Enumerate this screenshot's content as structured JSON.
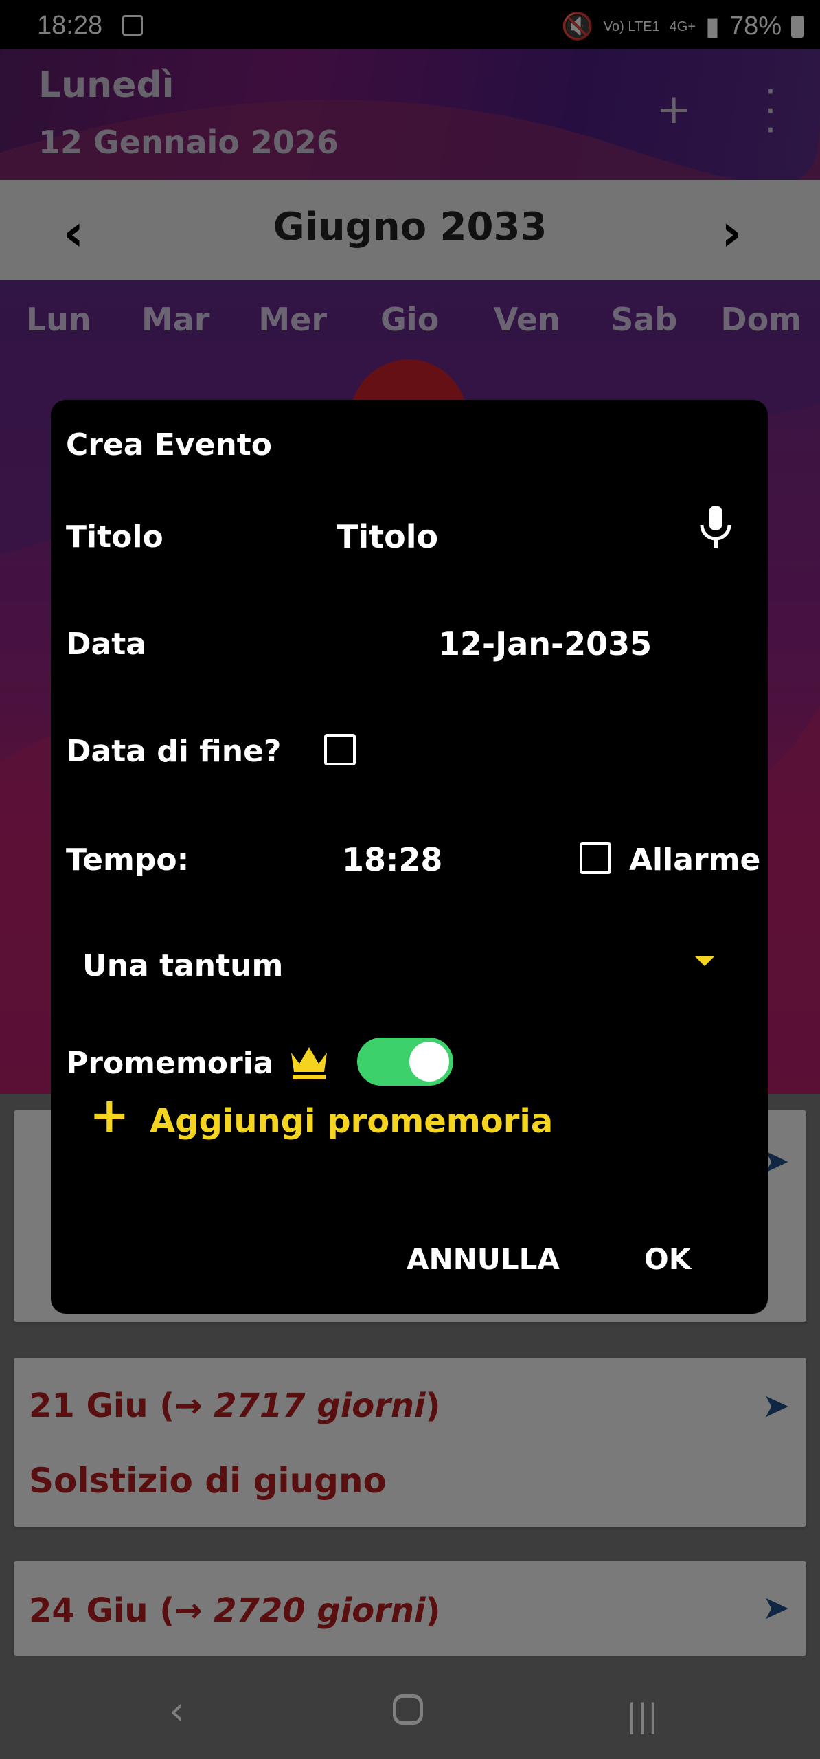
{
  "status": {
    "time": "18:28",
    "network": "Vo) LTE1",
    "network2": "4G+",
    "battery": "78%"
  },
  "header": {
    "day": "Lunedì",
    "date": "12 Gennaio 2026"
  },
  "calendar": {
    "month_title": "Giugno 2033",
    "weekdays": [
      "Lun",
      "Mar",
      "Mer",
      "Gio",
      "Ven",
      "Sab",
      "Dom"
    ]
  },
  "events": [
    {
      "date": "21 Giu",
      "days": "2717 giorni",
      "name": "Solstizio di giugno"
    },
    {
      "date": "24 Giu",
      "days": "2720 giorni"
    }
  ],
  "dialog": {
    "title": "Crea Evento",
    "title_label": "Titolo",
    "title_placeholder": "Titolo",
    "date_label": "Data",
    "date_value": "12-Jan-2035",
    "end_date_label": "Data di fine?",
    "time_label": "Tempo:",
    "time_value": "18:28",
    "alarm_label": "Allarme",
    "repeat_value": "Una tantum",
    "reminder_label": "Promemoria",
    "reminder_enabled": true,
    "add_reminder_label": "Aggiungi promemoria",
    "cancel_label": "ANNULLA",
    "ok_label": "OK"
  },
  "colors": {
    "accent": "#f5d41f",
    "toggle": "#3dd16b",
    "event_text": "#b21e1e"
  },
  "icons": [
    "microphone-icon",
    "crown-icon",
    "send-icon",
    "plus-icon",
    "more-vert-icon"
  ]
}
